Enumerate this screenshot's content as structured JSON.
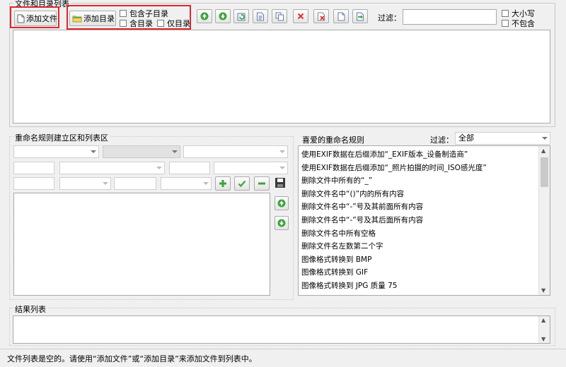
{
  "file_list": {
    "title": "文件和目录列表",
    "add_file": "添加文件",
    "add_dir": "添加目录",
    "include_subdirs": "包含子目录",
    "with_dirs": "含目录",
    "dirs_only": "仅目录",
    "filter_label": "过滤：",
    "filter_value": "",
    "case_sensitive": "大小写",
    "exclude": "不包含"
  },
  "rule_area": {
    "title": "重命名规则建立区和列表区"
  },
  "favorites": {
    "title": "喜爱的重命名规则",
    "filter_label": "过滤：",
    "filter_value": "全部",
    "rules": [
      "使用EXIF数据在后缀添加“_EXIF版本_设备制造商”",
      "使用EXIF数据在后缀添加“_照片拍摄的时间_ISO感光度”",
      "删除文件中所有的“_”",
      "删除文件名中“()”内的所有内容",
      "删除文件名中“-”号及其前面所有内容",
      "删除文件名中“-”号及其后面所有内容",
      "删除文件名中所有空格",
      "删除文件名左数第二个字",
      "图像格式转换到 BMP",
      "图像格式转换到 GIF",
      "图像格式转换到 JPG 质量 75"
    ]
  },
  "results": {
    "title": "结果列表"
  },
  "status": {
    "text": "文件列表是空的。请使用“添加文件”或“添加目录”来添加文件到列表中。"
  },
  "colors": {
    "highlight_box": "#e0262c",
    "green_icon": "#3aa53a",
    "red_icon": "#e03030"
  }
}
